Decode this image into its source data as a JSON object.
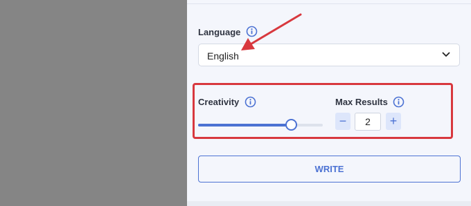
{
  "language": {
    "label": "Language",
    "selected": "English"
  },
  "creativity": {
    "label": "Creativity",
    "value_fraction": 0.75
  },
  "max_results": {
    "label": "Max Results",
    "value": "2",
    "decrement_symbol": "−",
    "increment_symbol": "+"
  },
  "actions": {
    "write_label": "WRITE"
  },
  "colors": {
    "accent": "#4c72d3",
    "annotation": "#d8383e",
    "panel_bg": "#f4f6fc",
    "backdrop": "#858585"
  },
  "icons": {
    "info": "info-icon",
    "dropdown": "chevron-down-icon"
  }
}
